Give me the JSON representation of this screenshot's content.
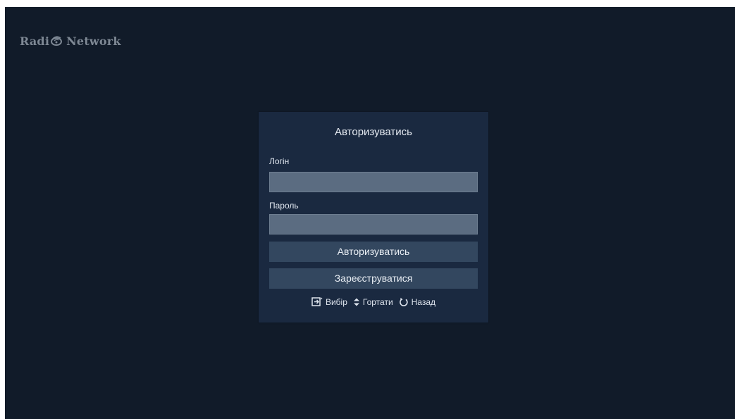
{
  "logo": {
    "word1": "Radi",
    "word2": "Network",
    "mark_icon": "satellite-dish-icon"
  },
  "login_panel": {
    "title": "Авторизуватись",
    "login": {
      "label": "Логін",
      "value": "",
      "placeholder": ""
    },
    "password": {
      "label": "Пароль",
      "value": "",
      "placeholder": ""
    },
    "login_button_label": "Авторизуватись",
    "register_button_label": "Зареєструватися"
  },
  "hints": [
    {
      "icon": "select-icon",
      "label": "Вибір"
    },
    {
      "icon": "up-down-arrows-icon",
      "label": "Гортати"
    },
    {
      "icon": "back-arrow-icon",
      "label": "Назад"
    }
  ],
  "colors": {
    "background": "#111b29",
    "panel": "#1a2940",
    "input": "#5b6c81",
    "button": "#33475f",
    "text": "#e6ebf2"
  }
}
